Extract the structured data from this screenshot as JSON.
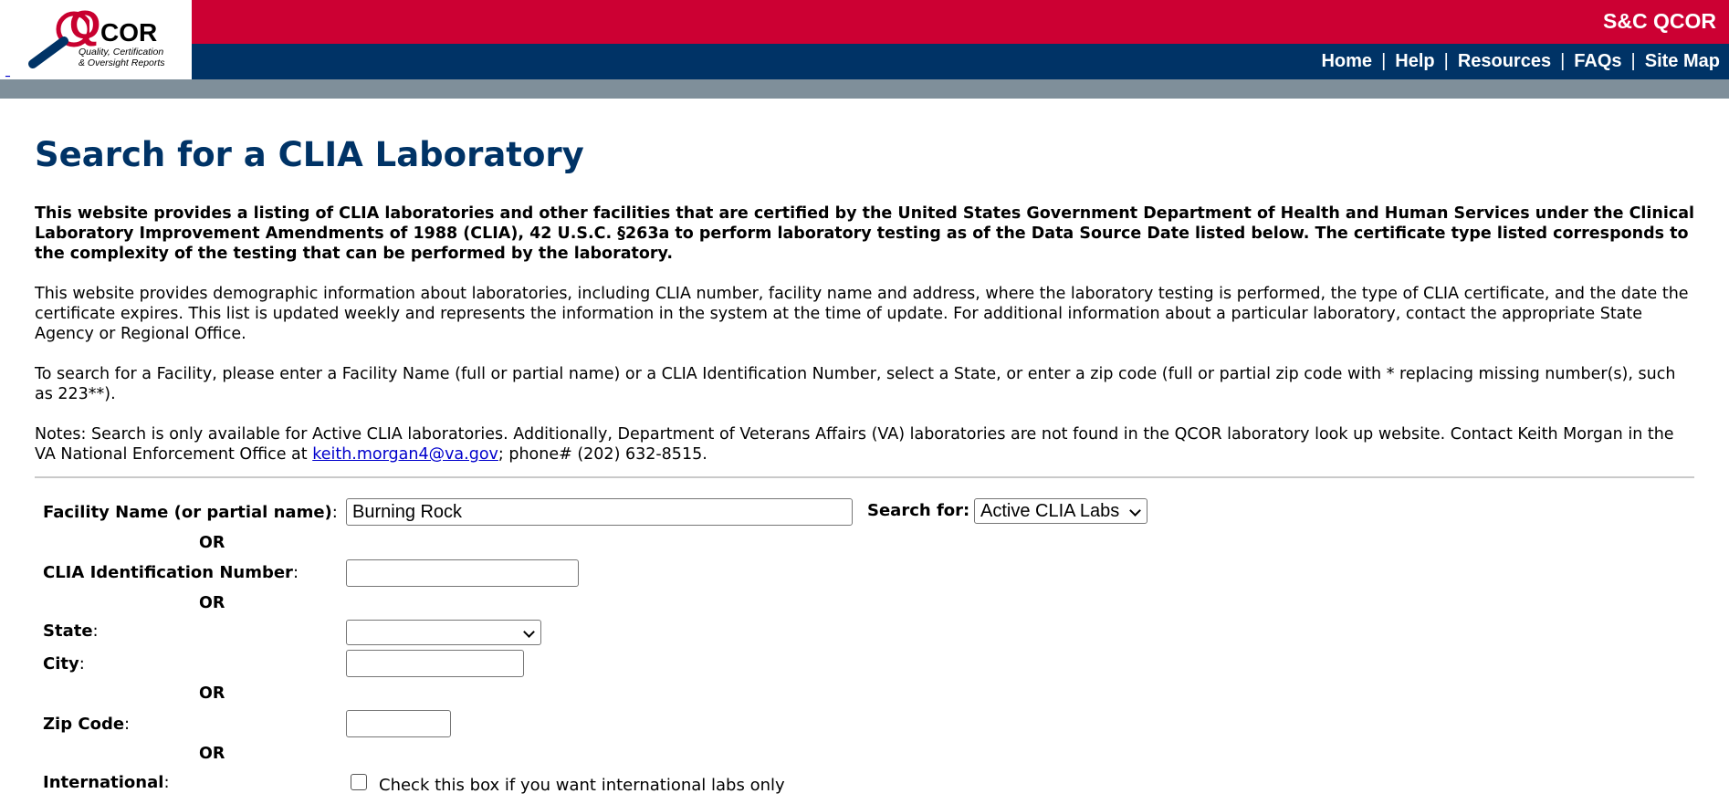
{
  "header": {
    "logo": {
      "letter_q": "Q",
      "letters_cor": "COR",
      "subtitle_line1": "Quality, Certification",
      "subtitle_line2": "& Oversight Reports",
      "icon": "magnifying-glass-icon"
    },
    "skip_link": "_",
    "site_title": "S&C QCOR",
    "nav": [
      "Home",
      "Help",
      "Resources",
      "FAQs",
      "Site Map"
    ],
    "nav_separator": "|",
    "colors": {
      "red_bar": "#cc0033",
      "blue_bar": "#003366",
      "gray_bar": "#7f8f9a"
    }
  },
  "main": {
    "title": "Search for a CLIA Laboratory",
    "intro_bold": "This website provides a listing of CLIA laboratories and other facilities that are certified by the United States Government Department of Health and Human Services under the Clinical Laboratory Improvement Amendments of 1988 (CLIA), 42 U.S.C. §263a to perform laboratory testing as of the Data Source Date listed below. The certificate type listed corresponds to the complexity of the testing that can be performed by the laboratory.",
    "paragraph_2": "This website provides demographic information about laboratories, including CLIA number, facility name and address, where the laboratory testing is performed, the type of CLIA certificate, and the date the certificate expires. This list is updated weekly and represents the information in the system at the time of update. For additional information about a particular laboratory, contact the appropriate State Agency or Regional Office.",
    "paragraph_3": "To search for a Facility, please enter a Facility Name (full or partial name) or a CLIA Identification Number, select a State, or enter a zip code (full or partial zip code with * replacing missing number(s), such as 223**).",
    "notes_prefix": "Notes: Search is only available for Active CLIA laboratories. Additionally, Department of Veterans Affairs (VA) laboratories are not found in the QCOR laboratory look up website. Contact Keith Morgan in the VA National Enforcement Office at ",
    "notes_email": "keith.morgan4@va.gov",
    "notes_suffix": "; phone# (202) 632-8515."
  },
  "form": {
    "facility_name_label": "Facility Name (or partial name)",
    "facility_name_value": "Burning Rock",
    "search_for_label": "Search for:",
    "search_for_value": "Active CLIA Labs",
    "or_text": "OR",
    "clia_label": "CLIA Identification Number",
    "clia_value": "",
    "state_label": "State",
    "state_value": "",
    "city_label": "City",
    "city_value": "",
    "zip_label": "Zip Code",
    "zip_value": "",
    "international_label": "International",
    "international_checkbox_label": "Check this box if you want international labs only",
    "international_checked": false,
    "colon": ":"
  }
}
